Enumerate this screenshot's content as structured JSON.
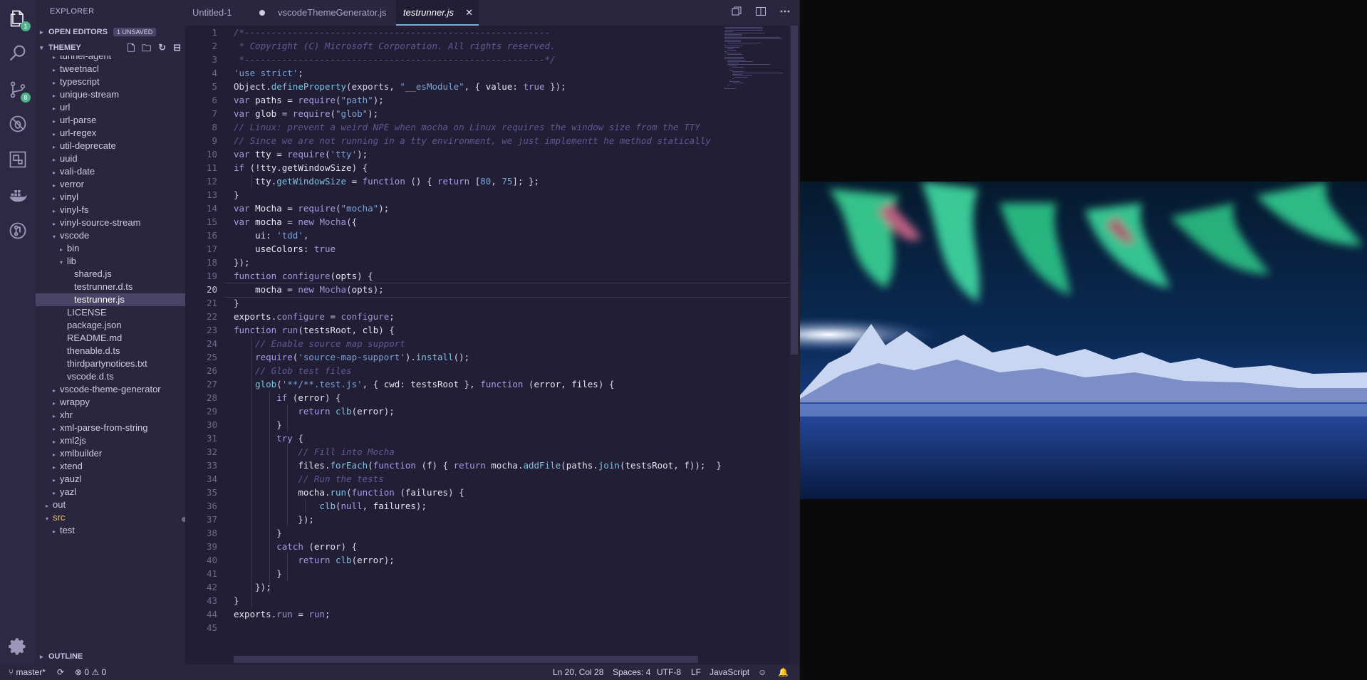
{
  "sidebar": {
    "title": "EXPLORER",
    "open_editors": "OPEN EDITORS",
    "unsaved_badge": "1 UNSAVED",
    "project": "THEMEY",
    "outline": "OUTLINE",
    "tree": [
      {
        "label": "tunnel-agent",
        "depth": 2,
        "chev": "▸"
      },
      {
        "label": "tweetnacl",
        "depth": 2,
        "chev": "▸"
      },
      {
        "label": "typescript",
        "depth": 2,
        "chev": "▸"
      },
      {
        "label": "unique-stream",
        "depth": 2,
        "chev": "▸"
      },
      {
        "label": "url",
        "depth": 2,
        "chev": "▸"
      },
      {
        "label": "url-parse",
        "depth": 2,
        "chev": "▸"
      },
      {
        "label": "url-regex",
        "depth": 2,
        "chev": "▸"
      },
      {
        "label": "util-deprecate",
        "depth": 2,
        "chev": "▸"
      },
      {
        "label": "uuid",
        "depth": 2,
        "chev": "▸"
      },
      {
        "label": "vali-date",
        "depth": 2,
        "chev": "▸"
      },
      {
        "label": "verror",
        "depth": 2,
        "chev": "▸"
      },
      {
        "label": "vinyl",
        "depth": 2,
        "chev": "▸"
      },
      {
        "label": "vinyl-fs",
        "depth": 2,
        "chev": "▸"
      },
      {
        "label": "vinyl-source-stream",
        "depth": 2,
        "chev": "▸"
      },
      {
        "label": "vscode",
        "depth": 2,
        "chev": "▾"
      },
      {
        "label": "bin",
        "depth": 3,
        "chev": "▸"
      },
      {
        "label": "lib",
        "depth": 3,
        "chev": "▾"
      },
      {
        "label": "shared.js",
        "depth": 4,
        "chev": ""
      },
      {
        "label": "testrunner.d.ts",
        "depth": 4,
        "chev": ""
      },
      {
        "label": "testrunner.js",
        "depth": 4,
        "chev": "",
        "selected": true
      },
      {
        "label": "LICENSE",
        "depth": 3,
        "chev": ""
      },
      {
        "label": "package.json",
        "depth": 3,
        "chev": ""
      },
      {
        "label": "README.md",
        "depth": 3,
        "chev": ""
      },
      {
        "label": "thenable.d.ts",
        "depth": 3,
        "chev": ""
      },
      {
        "label": "thirdpartynotices.txt",
        "depth": 3,
        "chev": ""
      },
      {
        "label": "vscode.d.ts",
        "depth": 3,
        "chev": ""
      },
      {
        "label": "vscode-theme-generator",
        "depth": 2,
        "chev": "▸"
      },
      {
        "label": "wrappy",
        "depth": 2,
        "chev": "▸"
      },
      {
        "label": "xhr",
        "depth": 2,
        "chev": "▸"
      },
      {
        "label": "xml-parse-from-string",
        "depth": 2,
        "chev": "▸"
      },
      {
        "label": "xml2js",
        "depth": 2,
        "chev": "▸"
      },
      {
        "label": "xmlbuilder",
        "depth": 2,
        "chev": "▸"
      },
      {
        "label": "xtend",
        "depth": 2,
        "chev": "▸"
      },
      {
        "label": "yauzl",
        "depth": 2,
        "chev": "▸"
      },
      {
        "label": "yazl",
        "depth": 2,
        "chev": "▸"
      },
      {
        "label": "out",
        "depth": 1,
        "chev": "▸"
      },
      {
        "label": "src",
        "depth": 1,
        "chev": "▾",
        "modified": true
      },
      {
        "label": "test",
        "depth": 2,
        "chev": "▸"
      }
    ]
  },
  "activity": {
    "explorer_badge": "1",
    "scm_badge": "8"
  },
  "tabs": [
    {
      "label": "Untitled-1",
      "dirty": true
    },
    {
      "label": "vscodeThemeGenerator.js"
    },
    {
      "label": "testrunner.js",
      "active": true
    }
  ],
  "editor": {
    "current_line": 20,
    "lines": [
      [
        [
          "c",
          "/*---------------------------------------------------------"
        ]
      ],
      [
        [
          "c",
          " * Copyright (C) Microsoft Corporation. All rights reserved."
        ]
      ],
      [
        [
          "c",
          " *--------------------------------------------------------*/"
        ]
      ],
      [
        [
          "s",
          "'use strict'"
        ],
        [
          "w",
          ";"
        ]
      ],
      [
        [
          "w",
          "Object"
        ],
        [
          "p",
          "."
        ],
        [
          "f",
          "defineProperty"
        ],
        [
          "w",
          "(exports, "
        ],
        [
          "s",
          "\"__esModule\""
        ],
        [
          "w",
          ", { "
        ],
        [
          "p",
          "value"
        ],
        [
          "w",
          ": "
        ],
        [
          "k",
          "true"
        ],
        [
          "w",
          " });"
        ]
      ],
      [
        [
          "k",
          "var "
        ],
        [
          "p",
          "paths"
        ],
        [
          "w",
          " = "
        ],
        [
          "k",
          "require"
        ],
        [
          "w",
          "("
        ],
        [
          "s",
          "\"path\""
        ],
        [
          "w",
          ");"
        ]
      ],
      [
        [
          "k",
          "var "
        ],
        [
          "p",
          "glob"
        ],
        [
          "w",
          " = "
        ],
        [
          "k",
          "require"
        ],
        [
          "w",
          "("
        ],
        [
          "s",
          "\"glob\""
        ],
        [
          "w",
          ");"
        ]
      ],
      [
        [
          "c",
          "// Linux: prevent a weird NPE when mocha on Linux requires the window size from the TTY"
        ]
      ],
      [
        [
          "c",
          "// Since we are not running in a tty environment, we just implementt he method statically"
        ]
      ],
      [
        [
          "k",
          "var "
        ],
        [
          "p",
          "tty"
        ],
        [
          "w",
          " = "
        ],
        [
          "k",
          "require"
        ],
        [
          "w",
          "("
        ],
        [
          "s",
          "'tty'"
        ],
        [
          "w",
          ");"
        ]
      ],
      [
        [
          "k",
          "if "
        ],
        [
          "w",
          "(!"
        ],
        [
          "p",
          "tty"
        ],
        [
          "w",
          "."
        ],
        [
          "p",
          "getWindowSize"
        ],
        [
          "w",
          ") {"
        ]
      ],
      [
        [
          "w",
          "    "
        ],
        [
          "p",
          "tty"
        ],
        [
          "w",
          "."
        ],
        [
          "f",
          "getWindowSize"
        ],
        [
          "w",
          " = "
        ],
        [
          "k",
          "function "
        ],
        [
          "w",
          "() { "
        ],
        [
          "k",
          "return "
        ],
        [
          "w",
          "["
        ],
        [
          "n",
          "80"
        ],
        [
          "w",
          ", "
        ],
        [
          "n",
          "75"
        ],
        [
          "w",
          "]; };"
        ]
      ],
      [
        [
          "w",
          "}"
        ]
      ],
      [
        [
          "k",
          "var "
        ],
        [
          "p",
          "Mocha"
        ],
        [
          "w",
          " = "
        ],
        [
          "k",
          "require"
        ],
        [
          "w",
          "("
        ],
        [
          "s",
          "\"mocha\""
        ],
        [
          "w",
          ");"
        ]
      ],
      [
        [
          "k",
          "var "
        ],
        [
          "p",
          "mocha"
        ],
        [
          "w",
          " = "
        ],
        [
          "k",
          "new "
        ],
        [
          "m",
          "Mocha"
        ],
        [
          "w",
          "({"
        ]
      ],
      [
        [
          "w",
          "    "
        ],
        [
          "p",
          "ui"
        ],
        [
          "w",
          ": "
        ],
        [
          "s",
          "'tdd'"
        ],
        [
          "w",
          ","
        ]
      ],
      [
        [
          "w",
          "    "
        ],
        [
          "p",
          "useColors"
        ],
        [
          "w",
          ": "
        ],
        [
          "k",
          "true"
        ]
      ],
      [
        [
          "w",
          "});"
        ]
      ],
      [
        [
          "k",
          "function "
        ],
        [
          "m",
          "configure"
        ],
        [
          "w",
          "("
        ],
        [
          "p",
          "opts"
        ],
        [
          "w",
          ") {"
        ]
      ],
      [
        [
          "w",
          "    "
        ],
        [
          "p",
          "mocha"
        ],
        [
          "w",
          " = "
        ],
        [
          "k",
          "new "
        ],
        [
          "m",
          "Mocha"
        ],
        [
          "w",
          "("
        ],
        [
          "p",
          "opts"
        ],
        [
          "w",
          ");"
        ]
      ],
      [
        [
          "w",
          "}"
        ]
      ],
      [
        [
          "p",
          "exports"
        ],
        [
          "w",
          "."
        ],
        [
          "m",
          "configure"
        ],
        [
          "w",
          " = "
        ],
        [
          "m",
          "configure"
        ],
        [
          "w",
          ";"
        ]
      ],
      [
        [
          "k",
          "function "
        ],
        [
          "m",
          "run"
        ],
        [
          "w",
          "("
        ],
        [
          "p",
          "testsRoot"
        ],
        [
          "w",
          ", "
        ],
        [
          "p",
          "clb"
        ],
        [
          "w",
          ") {"
        ]
      ],
      [
        [
          "w",
          "    "
        ],
        [
          "c",
          "// Enable source map support"
        ]
      ],
      [
        [
          "w",
          "    "
        ],
        [
          "k",
          "require"
        ],
        [
          "w",
          "("
        ],
        [
          "s",
          "'source-map-support'"
        ],
        [
          "w",
          ")."
        ],
        [
          "f",
          "install"
        ],
        [
          "w",
          "();"
        ]
      ],
      [
        [
          "w",
          "    "
        ],
        [
          "c",
          "// Glob test files"
        ]
      ],
      [
        [
          "w",
          "    "
        ],
        [
          "f",
          "glob"
        ],
        [
          "w",
          "("
        ],
        [
          "s",
          "'**/**.test.js'"
        ],
        [
          "w",
          ", { "
        ],
        [
          "p",
          "cwd"
        ],
        [
          "w",
          ": "
        ],
        [
          "p",
          "testsRoot"
        ],
        [
          "w",
          " }, "
        ],
        [
          "k",
          "function "
        ],
        [
          "w",
          "("
        ],
        [
          "p",
          "error"
        ],
        [
          "w",
          ", "
        ],
        [
          "p",
          "files"
        ],
        [
          "w",
          ") {"
        ]
      ],
      [
        [
          "w",
          "        "
        ],
        [
          "k",
          "if "
        ],
        [
          "w",
          "("
        ],
        [
          "p",
          "error"
        ],
        [
          "w",
          ") {"
        ]
      ],
      [
        [
          "w",
          "            "
        ],
        [
          "k",
          "return "
        ],
        [
          "f",
          "clb"
        ],
        [
          "w",
          "("
        ],
        [
          "p",
          "error"
        ],
        [
          "w",
          ");"
        ]
      ],
      [
        [
          "w",
          "        }"
        ]
      ],
      [
        [
          "w",
          "        "
        ],
        [
          "k",
          "try "
        ],
        [
          "w",
          "{"
        ]
      ],
      [
        [
          "w",
          "            "
        ],
        [
          "c",
          "// Fill into Mocha"
        ]
      ],
      [
        [
          "w",
          "            "
        ],
        [
          "p",
          "files"
        ],
        [
          "w",
          "."
        ],
        [
          "f",
          "forEach"
        ],
        [
          "w",
          "("
        ],
        [
          "k",
          "function "
        ],
        [
          "w",
          "("
        ],
        [
          "p",
          "f"
        ],
        [
          "w",
          ") { "
        ],
        [
          "k",
          "return "
        ],
        [
          "p",
          "mocha"
        ],
        [
          "w",
          "."
        ],
        [
          "f",
          "addFile"
        ],
        [
          "w",
          "("
        ],
        [
          "p",
          "paths"
        ],
        [
          "w",
          "."
        ],
        [
          "f",
          "join"
        ],
        [
          "w",
          "("
        ],
        [
          "p",
          "testsRoot"
        ],
        [
          "w",
          ", "
        ],
        [
          "p",
          "f"
        ],
        [
          "w",
          "));  }"
        ]
      ],
      [
        [
          "w",
          "            "
        ],
        [
          "c",
          "// Run the tests"
        ]
      ],
      [
        [
          "w",
          "            "
        ],
        [
          "p",
          "mocha"
        ],
        [
          "w",
          "."
        ],
        [
          "f",
          "run"
        ],
        [
          "w",
          "("
        ],
        [
          "k",
          "function "
        ],
        [
          "w",
          "("
        ],
        [
          "p",
          "failures"
        ],
        [
          "w",
          ") {"
        ]
      ],
      [
        [
          "w",
          "                "
        ],
        [
          "f",
          "clb"
        ],
        [
          "w",
          "("
        ],
        [
          "k",
          "null"
        ],
        [
          "w",
          ", "
        ],
        [
          "p",
          "failures"
        ],
        [
          "w",
          ");"
        ]
      ],
      [
        [
          "w",
          "            });"
        ]
      ],
      [
        [
          "w",
          "        }"
        ]
      ],
      [
        [
          "w",
          "        "
        ],
        [
          "k",
          "catch "
        ],
        [
          "w",
          "("
        ],
        [
          "p",
          "error"
        ],
        [
          "w",
          ") {"
        ]
      ],
      [
        [
          "w",
          "            "
        ],
        [
          "k",
          "return "
        ],
        [
          "f",
          "clb"
        ],
        [
          "w",
          "("
        ],
        [
          "p",
          "error"
        ],
        [
          "w",
          ");"
        ]
      ],
      [
        [
          "w",
          "        }"
        ]
      ],
      [
        [
          "w",
          "    });"
        ]
      ],
      [
        [
          "w",
          "}"
        ]
      ],
      [
        [
          "p",
          "exports"
        ],
        [
          "w",
          "."
        ],
        [
          "m",
          "run"
        ],
        [
          "w",
          " = "
        ],
        [
          "m",
          "run"
        ],
        [
          "w",
          ";"
        ]
      ],
      [
        [
          "w",
          ""
        ]
      ]
    ]
  },
  "status": {
    "branch": "master*",
    "errors": "0",
    "warnings": "0",
    "position": "Ln 20, Col 28",
    "spaces": "Spaces: 4",
    "encoding": "UTF-8",
    "eol": "LF",
    "language": "JavaScript"
  }
}
